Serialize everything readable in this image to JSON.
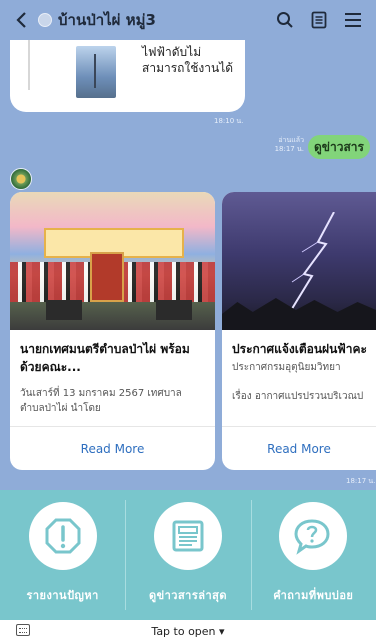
{
  "header": {
    "title": "บ้านป่าไผ่ หมู่3",
    "icons": [
      "back-icon",
      "search-icon",
      "notes-icon",
      "menu-icon"
    ]
  },
  "chat": {
    "prev_message_text": "ไฟฟ้าดับไม่สามารถใช้งานได้",
    "prev_time": "18:10 น.",
    "read_status": "อ่านแล้ว",
    "sent_time": "18:17 น.",
    "sent_message": "ดูข่าวสาร",
    "cards_time": "18:17 น.",
    "cards": [
      {
        "title": "นายกเทศมนตรีตำบลป่าไผ่ พร้อมด้วยคณะ...",
        "desc": "วันเสาร์ที่ 13 มกราคม 2567 เทศบาลตำบลป่าไผ่ นำโดย",
        "button": "Read More"
      },
      {
        "title": "ประกาศแจ้งเตือนฝนฟ้าคะ",
        "desc1": "ประกาศกรมอุตุนิยมวิทยา",
        "desc2": "เรื่อง อากาศแปรปรวนบริเวณป",
        "button": "Read More"
      }
    ]
  },
  "rich_menu": {
    "items": [
      {
        "label": "รายงานปัญหา",
        "icon": "alert-icon"
      },
      {
        "label": "ดูข่าวสารล่าสุด",
        "icon": "newspaper-icon"
      },
      {
        "label": "คำถามที่พบบ่อย",
        "icon": "question-icon"
      }
    ]
  },
  "bottom_bar": {
    "label": "Tap to open ▾"
  },
  "colors": {
    "chat_bg": "#8facd8",
    "sent_bubble": "#82d47a",
    "rich_menu_bg": "#79c6cc",
    "link": "#2f6fbf"
  }
}
